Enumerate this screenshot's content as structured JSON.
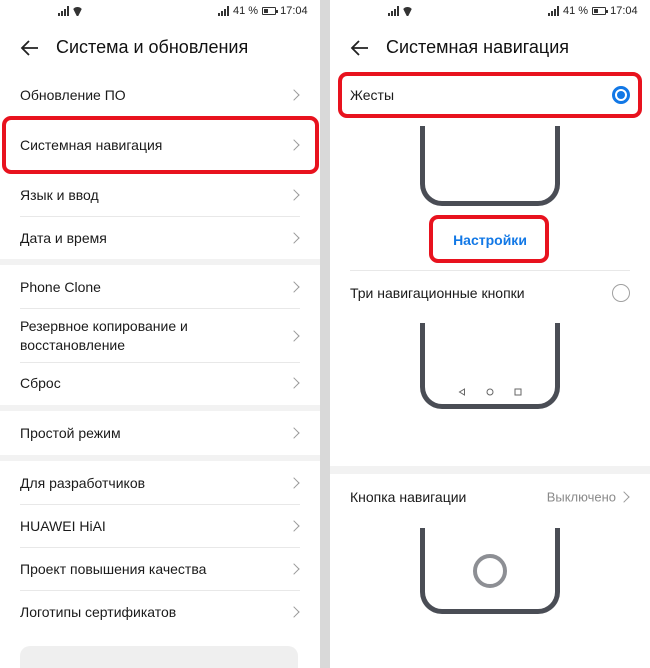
{
  "status_bar": {
    "battery": "41 %",
    "time": "17:04"
  },
  "left": {
    "title": "Система и обновления",
    "items": [
      {
        "label": "Обновление ПО"
      },
      {
        "label": "Системная навигация"
      },
      {
        "label": "Язык и ввод"
      },
      {
        "label": "Дата и время"
      },
      {
        "label": "Phone Clone"
      },
      {
        "label": "Резервное копирование и восстановление"
      },
      {
        "label": "Сброс"
      },
      {
        "label": "Простой режим"
      },
      {
        "label": "Для разработчиков"
      },
      {
        "label": "HUAWEI HiAI"
      },
      {
        "label": "Проект повышения качества"
      },
      {
        "label": "Логотипы сертификатов"
      }
    ]
  },
  "right": {
    "title": "Системная навигация",
    "gestures_label": "Жесты",
    "settings_link": "Настройки",
    "three_buttons_label": "Три навигационные кнопки",
    "nav_button_label": "Кнопка навигации",
    "nav_button_value": "Выключено"
  },
  "colors": {
    "accent": "#1278e6",
    "highlight": "#e8121e"
  }
}
